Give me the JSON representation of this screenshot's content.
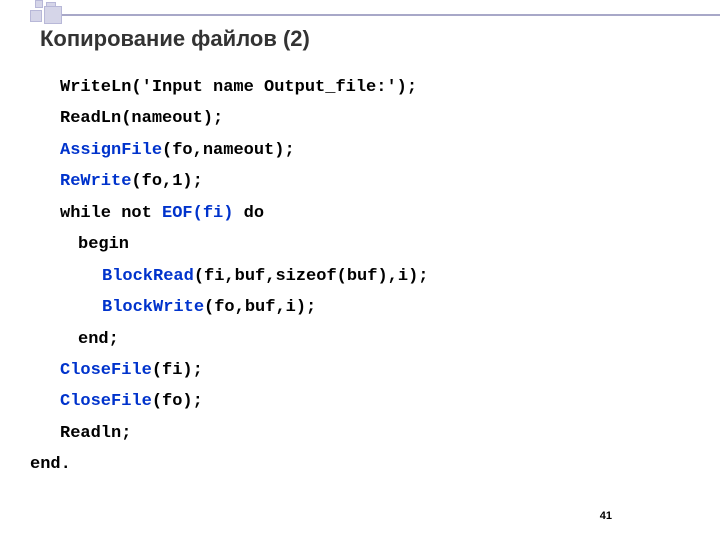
{
  "title": "Копирование файлов (2)",
  "code": {
    "l1a": "WriteLn('Input name Output_file:');",
    "l2a": "ReadLn(nameout);",
    "l3a": "AssignFile",
    "l3b": "(fo,nameout);",
    "l4a": "ReWrite",
    "l4b": "(fo,1);",
    "l5a": "while not ",
    "l5b": "EOF(fi)",
    "l5c": " do",
    "l6a": "begin",
    "l7a": "BlockRead",
    "l7b": "(fi,buf,sizeof(buf),i);",
    "l8a": "BlockWrite",
    "l8b": "(fo,buf,i);",
    "l9a": "end;",
    "l10a": "CloseFile",
    "l10b": "(fi);",
    "l11a": "CloseFile",
    "l11b": "(fo);",
    "l12a": "Readln;",
    "l13a": "end."
  },
  "page_number": "41"
}
